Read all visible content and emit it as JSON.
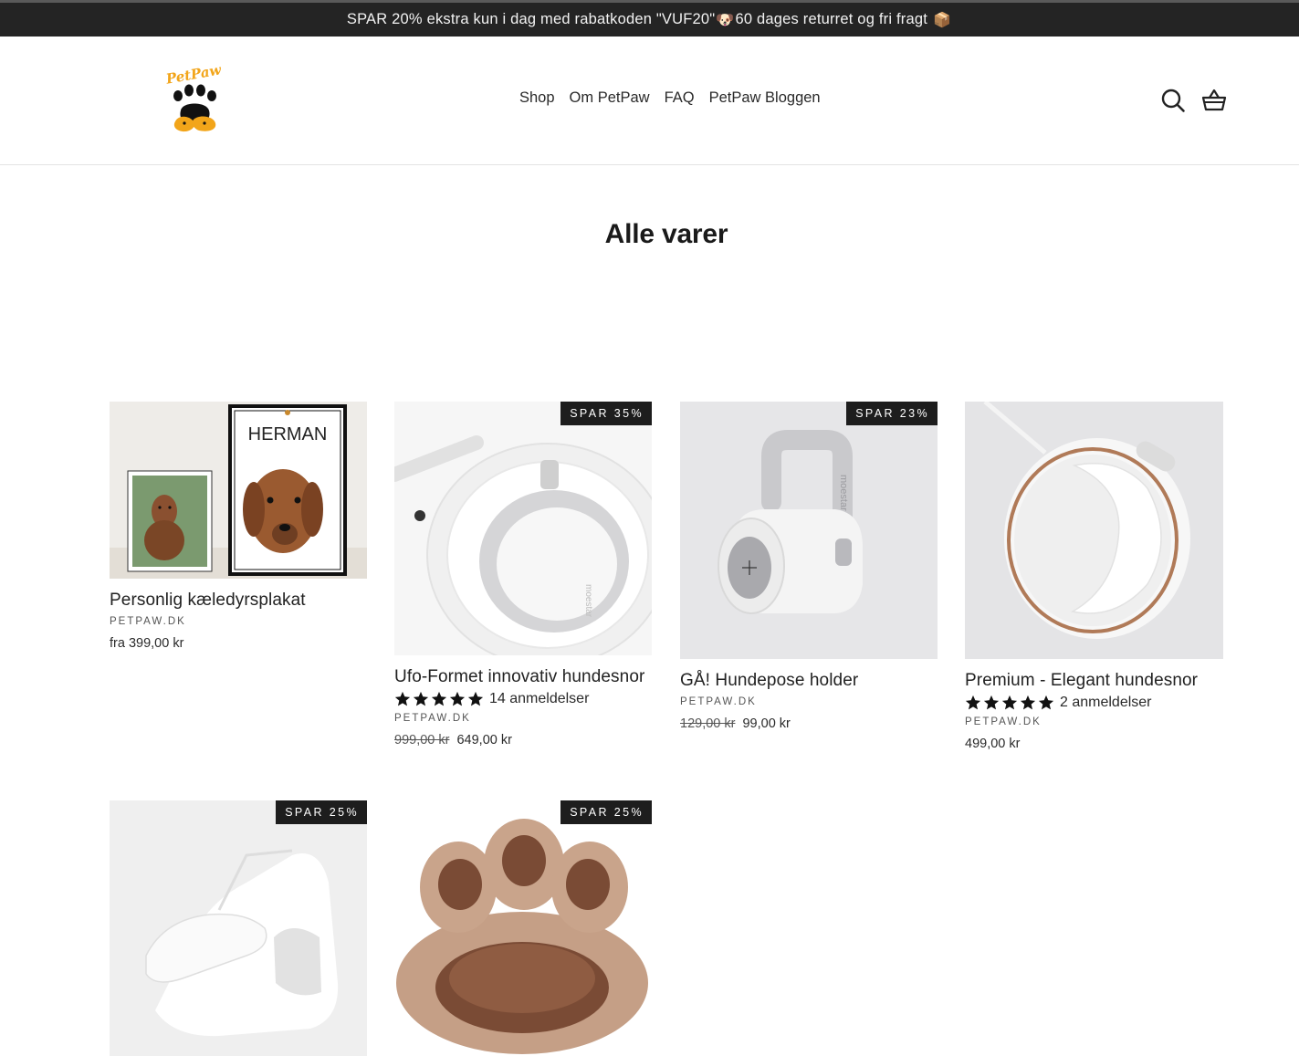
{
  "announcement": {
    "text_before": "SPAR 20% ekstra kun i dag med rabatkoden \"VUF20\"",
    "dog_emoji": "🐶",
    "text_after": "60 dages returret og fri fragt",
    "box_emoji": "📦"
  },
  "header": {
    "logo_text": "PetPaw",
    "nav": [
      "Shop",
      "Om PetPaw",
      "FAQ",
      "PetPaw Bloggen"
    ],
    "icons": [
      "search-icon",
      "basket-icon"
    ]
  },
  "page": {
    "title": "Alle varer"
  },
  "products": [
    {
      "title": "Personlig kæledyrsplakat",
      "vendor": "PETPAW.DK",
      "price": "fra 399,00 kr",
      "poster_name": "HERMAN"
    },
    {
      "title": "Ufo-Formet innovativ hundesnor",
      "badge": "SPAR 35%",
      "rating_count": "14 anmeldelser",
      "stars": 5,
      "vendor": "PETPAW.DK",
      "old_price": "999,00 kr",
      "price": "649,00 kr",
      "product_brand": "moestar"
    },
    {
      "title": "GÅ! Hundepose holder",
      "badge": "SPAR 23%",
      "vendor": "PETPAW.DK",
      "old_price": "129,00 kr",
      "price": "99,00 kr",
      "product_brand": "moestar"
    },
    {
      "title": "Premium - Elegant hundesnor",
      "rating_count": "2 anmeldelser",
      "stars": 5,
      "vendor": "PETPAW.DK",
      "price": "499,00 kr"
    },
    {
      "badge": "SPAR 25%"
    },
    {
      "badge": "SPAR 25%"
    }
  ],
  "colors": {
    "announcement_bg": "#242424",
    "badge_bg": "#1d1d1d",
    "text": "#222222"
  }
}
